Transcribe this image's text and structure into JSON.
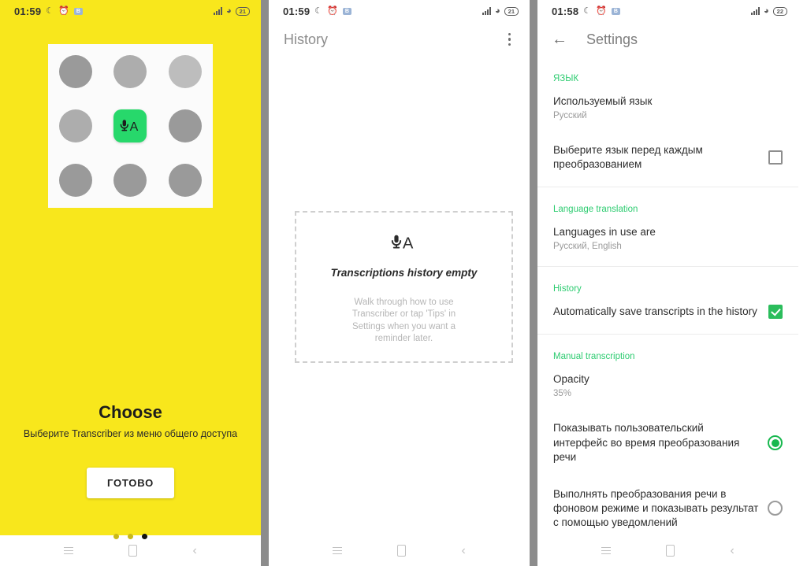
{
  "panel1": {
    "statusbar": {
      "time": "01:59",
      "moon_icon": "moon-icon",
      "alarm_icon": "alarm-icon",
      "badge": "B",
      "battery": "21"
    },
    "app_icon_label": "mic-a-icon",
    "title": "Choose",
    "subtitle": "Выберите Transcriber из меню общего доступа",
    "button_label": "ГОТОВО",
    "page_dots": {
      "count": 3,
      "active_index": 2
    }
  },
  "panel2": {
    "statusbar": {
      "time": "01:59",
      "moon_icon": "moon-icon",
      "alarm_icon": "alarm-icon",
      "badge": "B",
      "battery": "21"
    },
    "appbar": {
      "title": "History",
      "menu_icon": "overflow-menu-icon"
    },
    "empty_state": {
      "icon": "mic-a-icon",
      "title": "Transcriptions history empty",
      "description": "Walk through how to use Transcriber or tap 'Tips' in Settings when you want a reminder later."
    }
  },
  "panel3": {
    "statusbar": {
      "time": "01:58",
      "moon_icon": "moon-icon",
      "alarm_icon": "alarm-icon",
      "badge": "B",
      "battery": "22"
    },
    "appbar": {
      "back_icon": "back-arrow-icon",
      "title": "Settings"
    },
    "sections": [
      {
        "header": "язык"
      },
      {
        "header": "Language translation"
      },
      {
        "header": "History"
      },
      {
        "header": "Manual transcription"
      }
    ],
    "rows": {
      "used_language": {
        "title": "Используемый язык",
        "sub": "Русский"
      },
      "choose_each": {
        "title": "Выберите язык перед каждым преобразованием",
        "control": "checkbox",
        "checked": false
      },
      "languages_in_use": {
        "title": "Languages in use are",
        "sub": "Русский, English"
      },
      "auto_save": {
        "title": "Automatically save transcripts in the history",
        "control": "checkbox",
        "checked": true
      },
      "opacity": {
        "title": "Opacity",
        "sub": "35%"
      },
      "show_ui": {
        "title": "Показывать пользовательский интерфейс во время преобразования речи",
        "control": "radio",
        "checked": true
      },
      "background_mode": {
        "title": "Выполнять преобразования речи в фоновом режиме и показывать результат с помощью уведомлений",
        "control": "radio",
        "checked": false
      }
    }
  },
  "navbar": {
    "recents_label": "recents-icon",
    "home_label": "home-icon",
    "back_label": "back-icon"
  },
  "colors": {
    "yellow": "#f8e71c",
    "green_accent": "#2ecc71",
    "app_green": "#27d86b"
  }
}
